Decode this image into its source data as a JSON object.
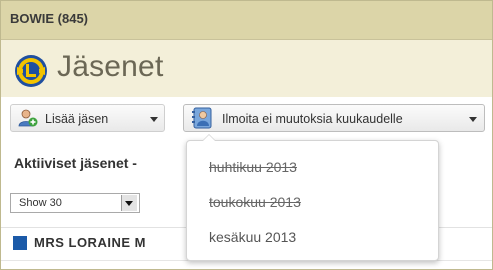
{
  "club": {
    "title": "BOWIE (845)"
  },
  "header": {
    "page_title": "Jäsenet"
  },
  "toolbar": {
    "add_member_label": "Lisää jäsen",
    "report_no_changes_label": "Ilmoita ei muutoksia kuukaudelle"
  },
  "dropdown": {
    "items": [
      {
        "label": "huhtikuu 2013",
        "status": "reported"
      },
      {
        "label": "toukokuu 2013",
        "status": "reported"
      },
      {
        "label": "kesäkuu 2013",
        "status": "open"
      }
    ]
  },
  "members": {
    "section_title": "Aktiiviset jäsenet -",
    "page_size": "Show 30",
    "rows": [
      {
        "name": "MRS  LORAINE  M"
      }
    ]
  },
  "colors": {
    "topbar": "#dcd5a8",
    "header_bg": "#f3efd9",
    "checkbox": "#1b5aa8"
  }
}
